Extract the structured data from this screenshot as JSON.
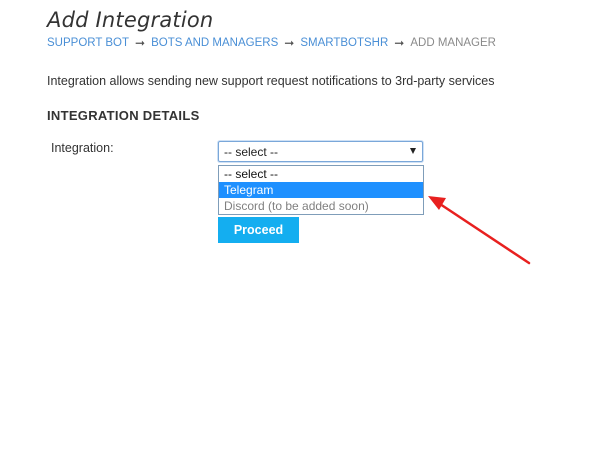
{
  "page": {
    "title": "Add Integration",
    "description": "Integration allows sending new support request notifications to 3rd-party services"
  },
  "breadcrumb": {
    "items": [
      "SUPPORT BOT",
      "BOTS AND MANAGERS",
      "SMARTBOTSHR",
      "ADD MANAGER"
    ],
    "separator": "➞"
  },
  "section": {
    "heading": "INTEGRATION DETAILS"
  },
  "form": {
    "integration_label": "Integration:",
    "integration_select": {
      "selected": "-- select --",
      "expanded": true,
      "options": [
        {
          "label": "-- select --",
          "state": "normal"
        },
        {
          "label": "Telegram",
          "state": "highlighted"
        },
        {
          "label": "Discord (to be added soon)",
          "state": "disabled"
        }
      ]
    },
    "proceed_label": "Proceed"
  },
  "colors": {
    "link": "#4a8fd6",
    "button": "#14aef0",
    "highlight": "#1e90ff",
    "annotation": "#e8201f"
  },
  "icons": {
    "select_caret": "caret-down-icon",
    "annotation": "red-arrow-icon"
  }
}
